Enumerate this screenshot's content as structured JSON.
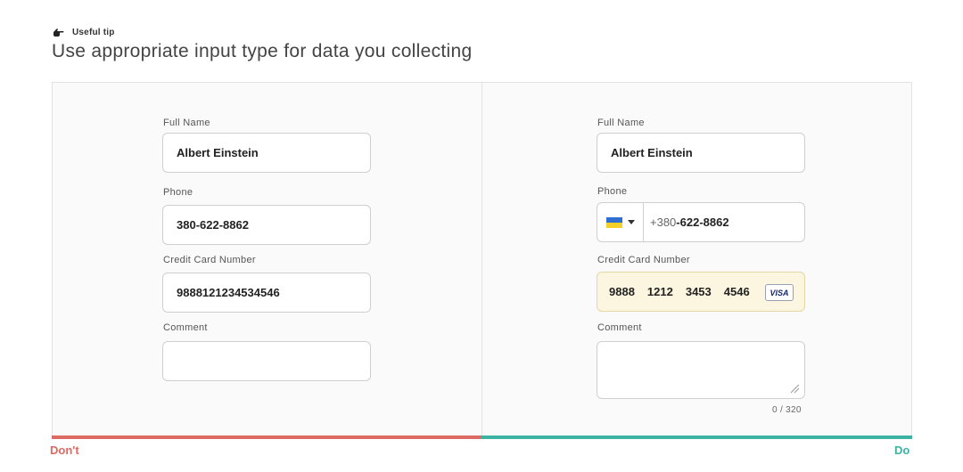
{
  "header": {
    "tip_icon": "pointing-hand-icon",
    "tip_label": "Useful tip",
    "title": "Use appropriate input type for data you collecting"
  },
  "colors": {
    "dont": "#de6a64",
    "do": "#3db3a3",
    "card_highlight": "#fcf5df"
  },
  "dont_panel": {
    "verdict": "Don't",
    "full_name": {
      "label": "Full Name",
      "value": "Albert Einstein"
    },
    "phone": {
      "label": "Phone",
      "value": "380-622-8862"
    },
    "card": {
      "label": "Credit Card Number",
      "value": "9888121234534546"
    },
    "comment": {
      "label": "Comment",
      "value": ""
    }
  },
  "do_panel": {
    "verdict": "Do",
    "full_name": {
      "label": "Full Name",
      "value": "Albert Einstein"
    },
    "phone": {
      "label": "Phone",
      "country_flag": "ukraine-flag-icon",
      "prefix": "+380",
      "value": "-622-8862"
    },
    "card": {
      "label": "Credit Card Number",
      "groups": [
        "9888",
        "1212",
        "3453",
        "4546"
      ],
      "brand": "VISA"
    },
    "comment": {
      "label": "Comment",
      "value": "",
      "counter": "0 / 320"
    }
  }
}
